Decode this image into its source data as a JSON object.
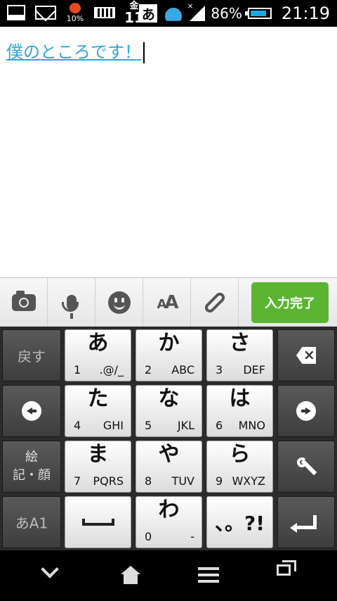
{
  "status_bar": {
    "battery_saver_text": "10%",
    "calendar_weekday": "金",
    "calendar_day": "11",
    "ime_indicator": "あ",
    "battery_percent": "86%",
    "time": "21:19",
    "battery_level": 0.86,
    "accent_color": "#1aa9e0"
  },
  "editor": {
    "text": "僕のところです！",
    "text_color": "#2ea8d8"
  },
  "toolbar": {
    "aa_big": "A",
    "aa_small": "A",
    "done_label": "入力完了",
    "done_color": "#5cb532"
  },
  "keyboard": {
    "left_col": {
      "back_label": "戻す",
      "emoji_line1": "絵",
      "emoji_line2": "記・顔",
      "mode_hira": "あ",
      "mode_rest": "A1"
    },
    "keys": [
      {
        "kana": "あ",
        "digit": "1",
        "chars": ".@/_"
      },
      {
        "kana": "か",
        "digit": "2",
        "chars": "ABC"
      },
      {
        "kana": "さ",
        "digit": "3",
        "chars": "DEF"
      },
      {
        "kana": "た",
        "digit": "4",
        "chars": "GHI"
      },
      {
        "kana": "な",
        "digit": "5",
        "chars": "JKL"
      },
      {
        "kana": "は",
        "digit": "6",
        "chars": "MNO"
      },
      {
        "kana": "ま",
        "digit": "7",
        "chars": "PQRS"
      },
      {
        "kana": "や",
        "digit": "8",
        "chars": "TUV"
      },
      {
        "kana": "ら",
        "digit": "9",
        "chars": "WXYZ"
      },
      {
        "kana": "わ",
        "digit": "0",
        "chars": "-"
      }
    ],
    "punct_label": "、。?!"
  }
}
